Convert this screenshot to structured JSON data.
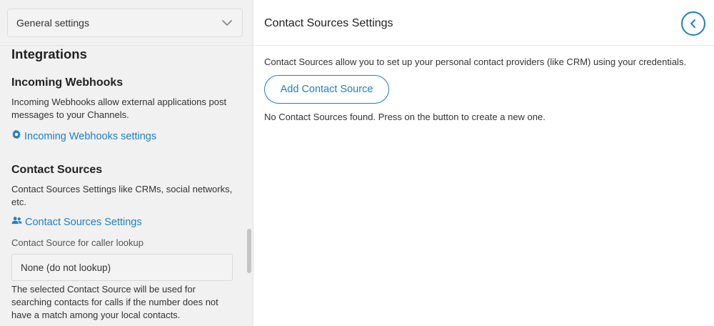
{
  "sidebar": {
    "dropdown_value": "General settings",
    "heading": "Integrations",
    "webhooks": {
      "title": "Incoming Webhooks",
      "description": "Incoming Webhooks allow external applications post messages to your Channels.",
      "link_label": "Incoming Webhooks settings",
      "link_icon": "gear-icon"
    },
    "contact_sources": {
      "title": "Contact Sources",
      "description": "Contact Sources Settings like CRMs, social networks, etc.",
      "link_label": "Contact Sources Settings",
      "link_icon": "users-icon",
      "lookup_label": "Contact Source for caller lookup",
      "lookup_value": "None (do not lookup)",
      "lookup_help": "The selected Contact Source will be used for searching contacts for calls if the number does not have a match among your local contacts."
    }
  },
  "main": {
    "title": "Contact Sources Settings",
    "back_icon": "chevron-left-icon",
    "description": "Contact Sources allow you to set up your personal contact providers (like CRM) using your credentials.",
    "add_button_label": "Add Contact Source",
    "empty_message": "No Contact Sources found. Press on the button to create a new one."
  },
  "colors": {
    "accent": "#1f7fc4",
    "sidebar_bg": "#f1f1f1"
  }
}
